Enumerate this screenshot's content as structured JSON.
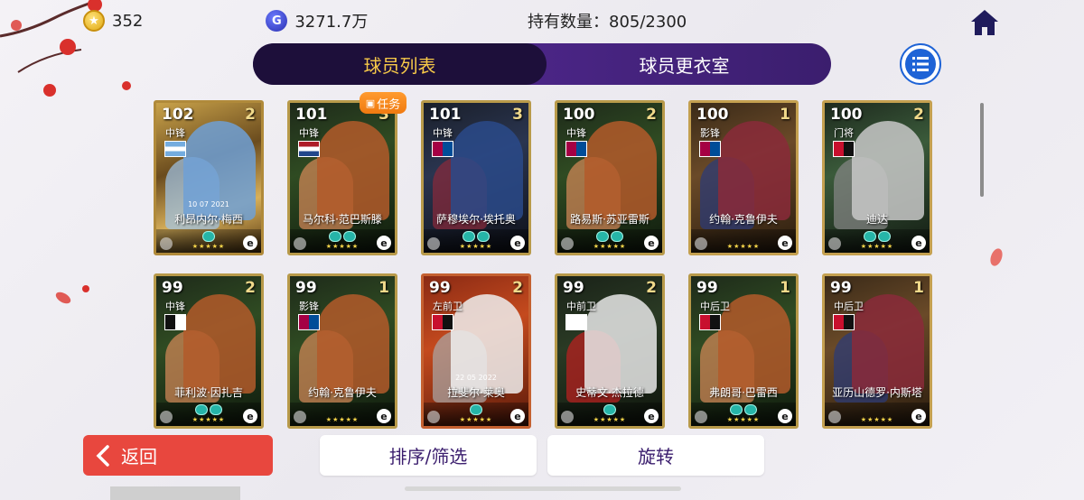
{
  "topbar": {
    "coins": "352",
    "gp": "3271.7万",
    "gp_icon_letter": "G",
    "owned": "持有数量：805/2300"
  },
  "tabs": [
    {
      "label": "球员列表",
      "active": true
    },
    {
      "label": "球员更衣室",
      "active": false
    }
  ],
  "task_badge": "任务",
  "cards": [
    {
      "rating": "102",
      "level": "2",
      "position": "中锋",
      "name": "利昂内尔·梅西",
      "date": "10 07 2021",
      "flag": "argentina",
      "theme": "messi",
      "skills": 1
    },
    {
      "rating": "101",
      "level": "3",
      "position": "中锋",
      "name": "马尔科·范巴斯滕",
      "date": "",
      "flag": "netherlands",
      "theme": "green",
      "skills": 2
    },
    {
      "rating": "101",
      "level": "3",
      "position": "中锋",
      "name": "萨穆埃尔·埃托奥",
      "date": "",
      "flag": "barca",
      "theme": "dark",
      "skills": 2
    },
    {
      "rating": "100",
      "level": "2",
      "position": "中锋",
      "name": "路易斯·苏亚雷斯",
      "date": "",
      "flag": "barca",
      "theme": "green",
      "skills": 2
    },
    {
      "rating": "100",
      "level": "1",
      "position": "影锋",
      "name": "约翰·克鲁伊夫",
      "date": "",
      "flag": "barca",
      "theme": "brown",
      "skills": 0
    },
    {
      "rating": "100",
      "level": "2",
      "position": "门将",
      "name": "迪达",
      "date": "",
      "flag": "milan",
      "theme": "greenlight",
      "skills": 2
    },
    {
      "rating": "99",
      "level": "2",
      "position": "中锋",
      "name": "菲利波·因扎吉",
      "date": "",
      "flag": "juve",
      "theme": "green",
      "skills": 2
    },
    {
      "rating": "99",
      "level": "1",
      "position": "影锋",
      "name": "约翰·克鲁伊夫",
      "date": "",
      "flag": "barca",
      "theme": "green",
      "skills": 0
    },
    {
      "rating": "99",
      "level": "2",
      "position": "左前卫",
      "name": "拉斐尔·莱奥",
      "date": "22 05 2022",
      "flag": "milan",
      "theme": "red",
      "skills": 1
    },
    {
      "rating": "99",
      "level": "2",
      "position": "中前卫",
      "name": "史蒂文·杰拉德",
      "date": "",
      "flag": "england",
      "theme": "darkgreen",
      "skills": 1
    },
    {
      "rating": "99",
      "level": "1",
      "position": "中后卫",
      "name": "弗朗哥·巴雷西",
      "date": "",
      "flag": "milan",
      "theme": "green",
      "skills": 2
    },
    {
      "rating": "99",
      "level": "1",
      "position": "中后卫",
      "name": "亚历山德罗·内斯塔",
      "date": "",
      "flag": "milan",
      "theme": "brown",
      "skills": 0
    }
  ],
  "stars": "★★★★★",
  "e_icon": "e",
  "bottom": {
    "back_label": "返回",
    "sort_label": "排序/筛选",
    "rotate_label": "旋转"
  },
  "colors": {
    "tab_active_text": "#f7c948",
    "back_button": "#e8473e",
    "tabs_bg": "#3a1f6b"
  },
  "icons": {
    "home": "home-icon",
    "list": "list-icon",
    "coin": "coin-icon",
    "gp": "gp-icon",
    "back": "chevron-left-icon",
    "gift": "gift-icon"
  }
}
